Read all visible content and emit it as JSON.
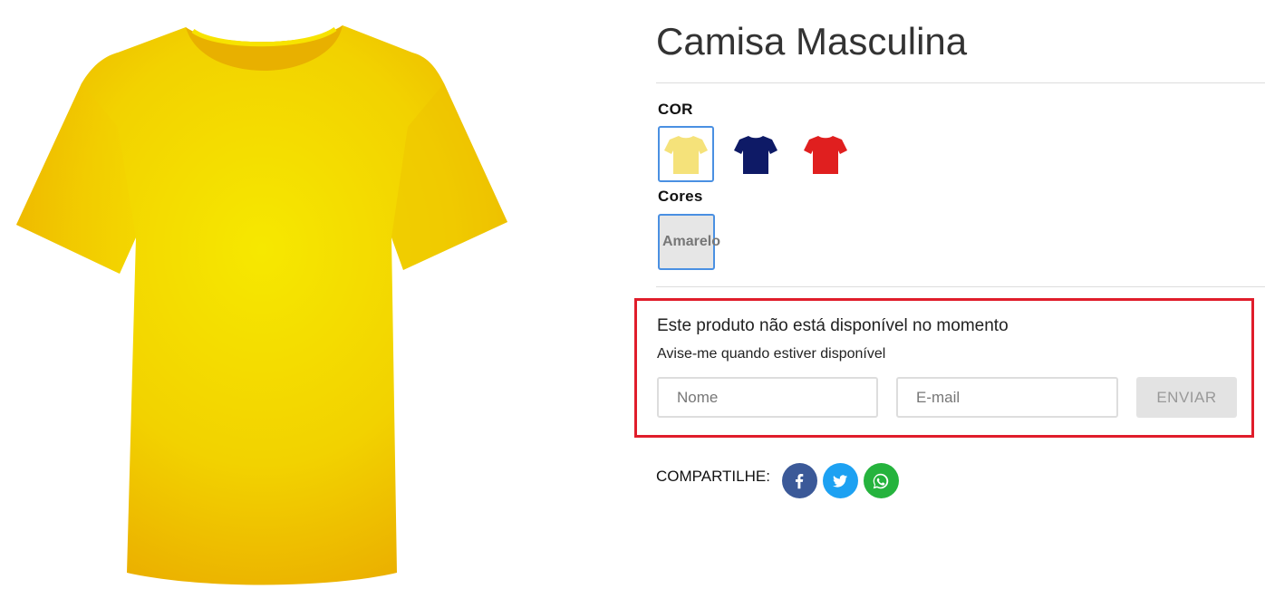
{
  "product": {
    "title": "Camisa Masculina",
    "image_alt": "yellow t-shirt",
    "main_color": "#f2c300"
  },
  "color_option": {
    "label": "COR",
    "swatches": [
      {
        "name": "yellow-shirt",
        "color": "#f5e27a",
        "selected": true
      },
      {
        "name": "navy-shirt",
        "color": "#0e1a66",
        "selected": false
      },
      {
        "name": "red-shirt",
        "color": "#e01f1f",
        "selected": false
      }
    ]
  },
  "variant_option": {
    "label": "Cores",
    "selected_value": "Amarelo"
  },
  "notify": {
    "title": "Este produto não está disponível no momento",
    "subtitle": "Avise-me quando estiver disponível",
    "name_placeholder": "Nome",
    "email_placeholder": "E-mail",
    "submit_label": "ENVIAR",
    "highlight_color": "#e01d2b"
  },
  "share": {
    "label": "COMPARTILHE:",
    "networks": [
      {
        "name": "facebook",
        "icon": "facebook-icon",
        "color": "#3b5998"
      },
      {
        "name": "twitter",
        "icon": "twitter-icon",
        "color": "#1da1f2"
      },
      {
        "name": "whatsapp",
        "icon": "whatsapp-icon",
        "color": "#25b33d"
      }
    ]
  }
}
